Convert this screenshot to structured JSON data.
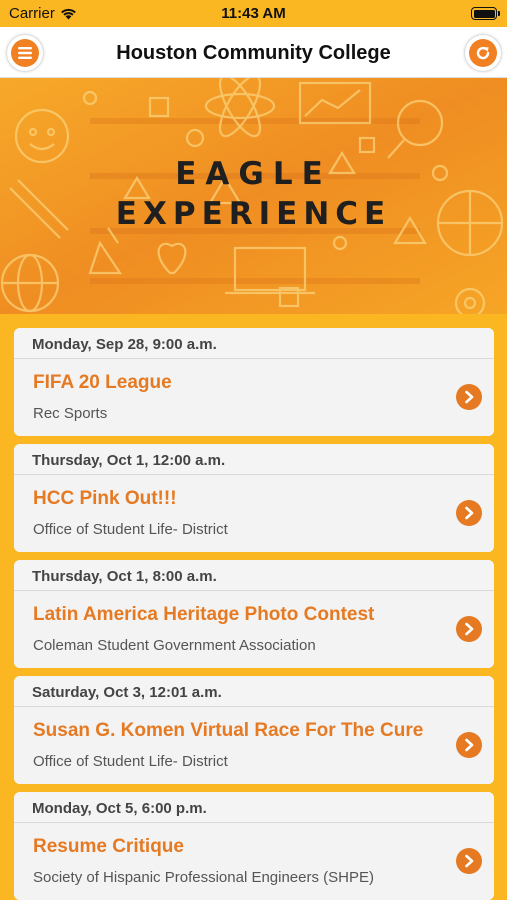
{
  "status": {
    "carrier": "Carrier",
    "time": "11:43 AM"
  },
  "nav": {
    "title": "Houston Community College",
    "menu_icon": "menu-icon",
    "refresh_icon": "refresh-icon"
  },
  "banner": {
    "line1": "EAGLE",
    "line2": "EXPERIENCE"
  },
  "colors": {
    "accent": "#e57a23",
    "background": "#fbb721"
  },
  "events": [
    {
      "date": "Monday, Sep 28, 9:00 a.m.",
      "title": "FIFA 20 League",
      "org": "Rec Sports"
    },
    {
      "date": "Thursday, Oct 1, 12:00 a.m.",
      "title": "HCC Pink Out!!!",
      "org": "Office of Student Life- District"
    },
    {
      "date": "Thursday, Oct 1, 8:00 a.m.",
      "title": "Latin America Heritage Photo Contest",
      "org": "Coleman Student Government Association"
    },
    {
      "date": "Saturday, Oct 3, 12:01 a.m.",
      "title": "Susan G. Komen Virtual Race For The Cure",
      "org": "Office of Student Life- District"
    },
    {
      "date": "Monday, Oct 5, 6:00 p.m.",
      "title": "Resume Critique",
      "org": "Society of Hispanic Professional Engineers (SHPE)"
    }
  ]
}
